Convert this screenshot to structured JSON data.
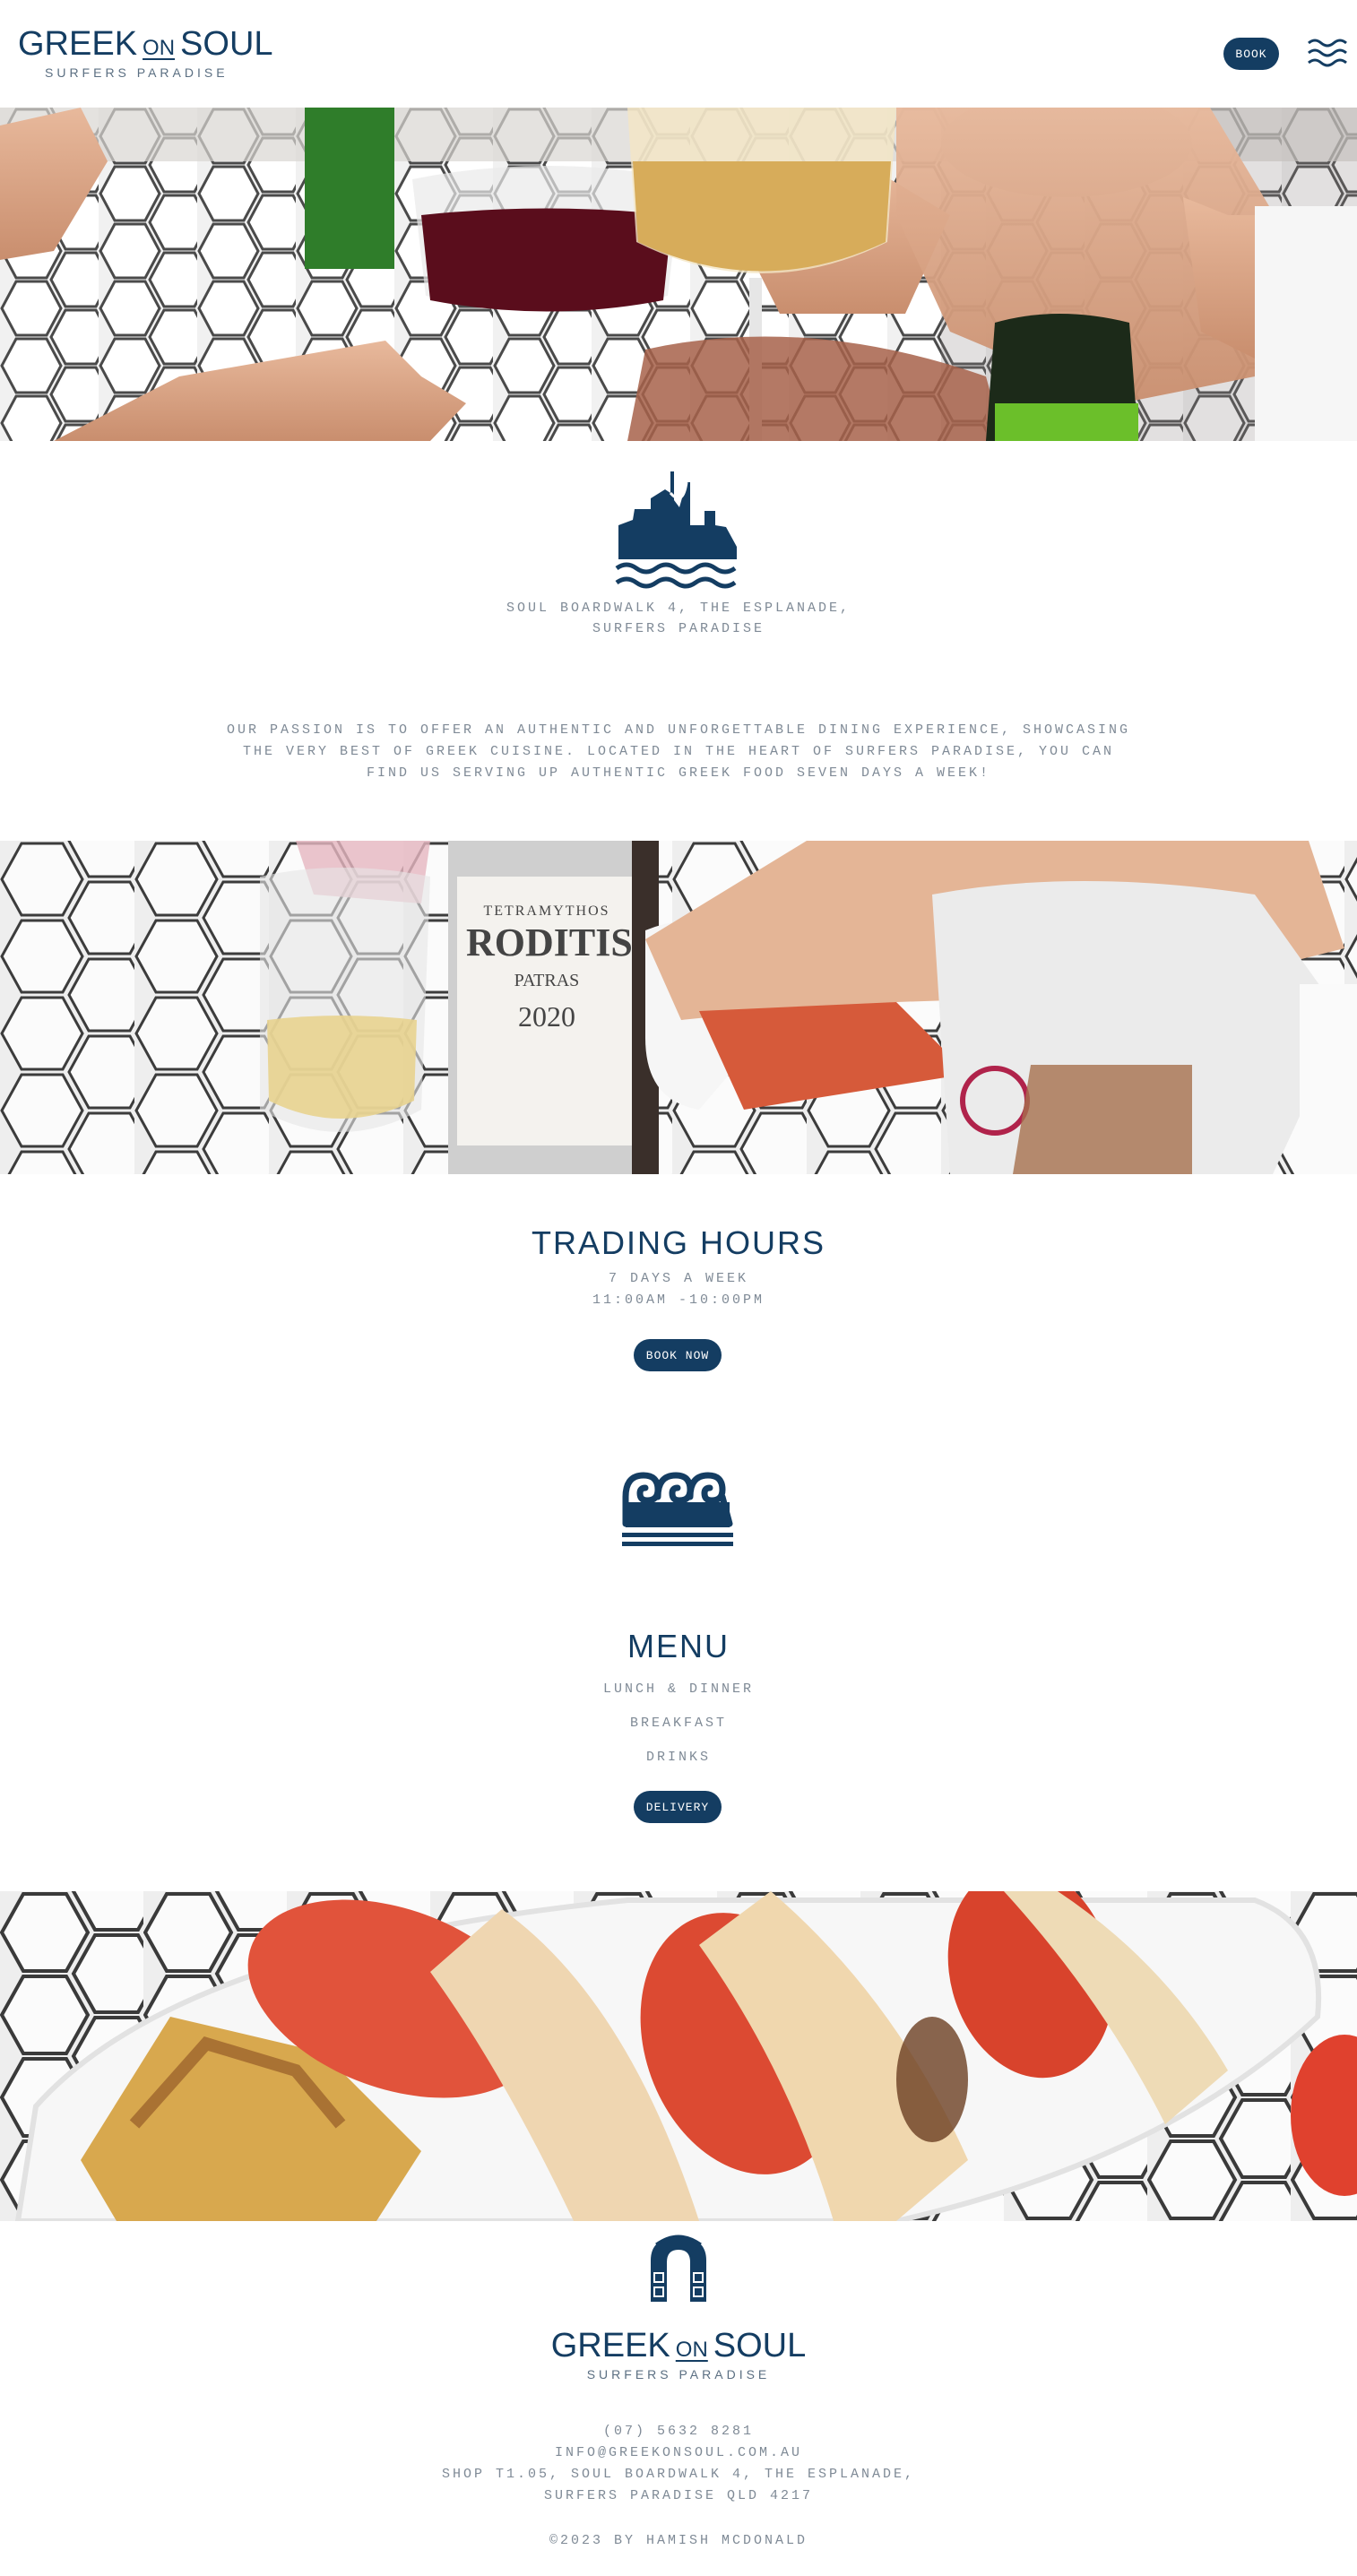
{
  "header": {
    "logo_word1": "GREEK",
    "logo_on": "ON",
    "logo_word2": "SOUL",
    "logo_sub": "SURFERS PARADISE",
    "book_label": "BOOK",
    "menu_icon": "waves-menu-icon"
  },
  "hero_images": {
    "image1": "photo-clinking-wine-glasses",
    "image2": "photo-roditis-wine-bottle-table",
    "image3": "photo-halloumi-tomato-pita-platter"
  },
  "location": {
    "emblem_icon": "ship-waves-icon",
    "address_line1": "SOUL BOARDWALK 4, THE ESPLANADE,",
    "address_line2": "SURFERS PARADISE"
  },
  "intro": {
    "line1": "OUR PASSION IS TO OFFER AN AUTHENTIC AND UNFORGETTABLE DINING EXPERIENCE, SHOWCASING",
    "line2": "THE VERY BEST OF GREEK CUISINE. LOCATED IN THE HEART OF SURFERS PARADISE, YOU CAN",
    "line3": "FIND US SERVING UP AUTHENTIC GREEK FOOD SEVEN DAYS A WEEK!"
  },
  "hours": {
    "title": "TRADING HOURS",
    "days": "7 DAYS A WEEK",
    "times": "11:00AM -10:00PM",
    "book_now_label": "BOOK NOW"
  },
  "waves_icon": "greek-waves-icon",
  "menu": {
    "title": "MENU",
    "items": [
      "LUNCH & DINNER",
      "BREAKFAST",
      "DRINKS"
    ],
    "delivery_label": "DELIVERY"
  },
  "footer": {
    "arch_icon": "greek-arch-icon",
    "logo_word1": "GREEK",
    "logo_on": "ON",
    "logo_word2": "SOUL",
    "logo_sub": "SURFERS PARADISE",
    "phone": "(07) 5632 8281",
    "email": "INFO@GREEKONSOUL.COM.AU",
    "address_line1": "SHOP T1.05, SOUL BOARDWALK 4, THE ESPLANADE,",
    "address_line2": "SURFERS PARADISE QLD 4217",
    "copyright": "©2023 BY HAMISH MCDONALD"
  },
  "colors": {
    "brand_navy": "#143d62",
    "text_grey": "#7f8a96",
    "background": "#ffffff"
  }
}
